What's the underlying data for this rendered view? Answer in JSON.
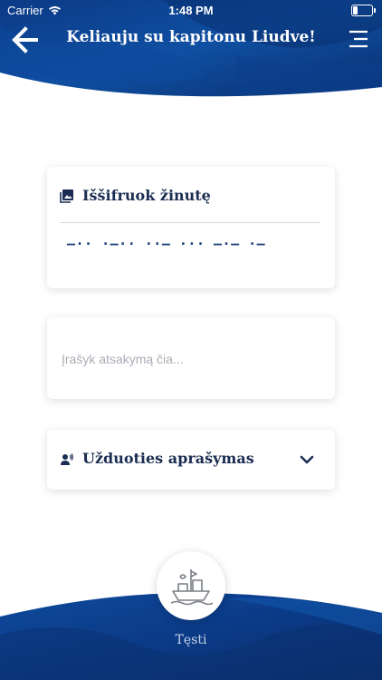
{
  "status_bar": {
    "carrier": "Carrier",
    "time": "1:48 PM"
  },
  "header": {
    "title": "Keliauju su kapitonu Liudve!",
    "back_icon": "arrow-left-icon",
    "menu_icon": "menu-icon"
  },
  "message_card": {
    "icon": "image-icon",
    "heading": "Iššifruok žinutę",
    "morse": "–·· ·–·· ··– ··· –·– ·–"
  },
  "answer_card": {
    "placeholder": "Įrašyk atsakymą čia..."
  },
  "description_card": {
    "icon": "speaker-person-icon",
    "heading": "Užduoties aprašymas",
    "toggle_icon": "chevron-down-icon"
  },
  "footer": {
    "continue_icon": "ship-icon",
    "continue_label": "Tęsti"
  },
  "colors": {
    "primary_dark": "#0a2d66",
    "primary": "#0f4ea0",
    "navy_text": "#1b2d52"
  }
}
